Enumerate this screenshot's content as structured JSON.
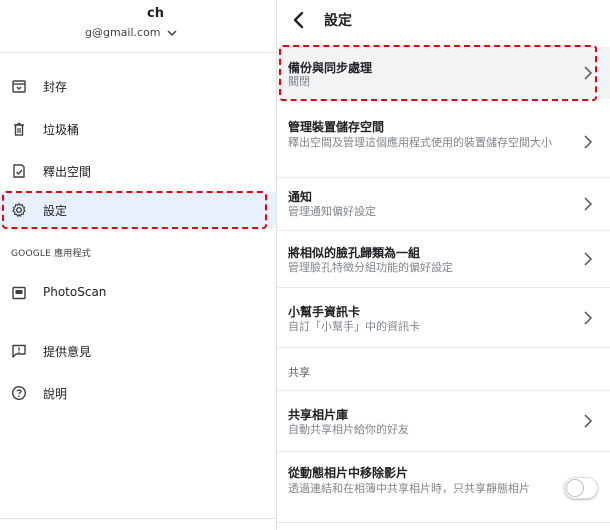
{
  "account": {
    "name": "ch",
    "email": "g@gmail.com"
  },
  "left_nav": {
    "items": [
      {
        "label": "封存",
        "icon": "archive-icon"
      },
      {
        "label": "垃圾桶",
        "icon": "trash-icon"
      },
      {
        "label": "釋出空間",
        "icon": "free-up-space-icon"
      },
      {
        "label": "設定",
        "icon": "gear-icon",
        "active": true
      }
    ],
    "google_apps_header": "GOOGLE 應用程式",
    "apps": [
      {
        "label": "PhotoScan",
        "icon": "photoscan-icon"
      }
    ],
    "footer_items": [
      {
        "label": "提供意見",
        "icon": "feedback-icon"
      },
      {
        "label": "說明",
        "icon": "help-icon"
      }
    ]
  },
  "settings": {
    "title": "設定",
    "rows": [
      {
        "title": "備份與同步處理",
        "subtitle": "關閉"
      },
      {
        "title": "管理裝置儲存空間",
        "subtitle": "釋出空間及管理這個應用程式使用的裝置儲存空間大小"
      },
      {
        "title": "通知",
        "subtitle": "管理通知偏好設定"
      },
      {
        "title": "將相似的臉孔歸類為一組",
        "subtitle": "管理臉孔特徵分組功能的偏好設定"
      },
      {
        "title": "小幫手資訊卡",
        "subtitle": "自訂「小幫手」中的資訊卡"
      }
    ],
    "sharing_header": "共享",
    "sharing_rows": [
      {
        "title": "共享相片庫",
        "subtitle": "自動共享相片給你的好友"
      },
      {
        "title": "從動態相片中移除影片",
        "subtitle": "透過連結和在相簿中共享相片時，只共享靜態相片",
        "toggle": false
      }
    ]
  },
  "colors": {
    "highlight_dashed": "#e8000b",
    "active_nav_bg": "#e8f0fe",
    "selected_row_bg": "#f1f3f4"
  }
}
